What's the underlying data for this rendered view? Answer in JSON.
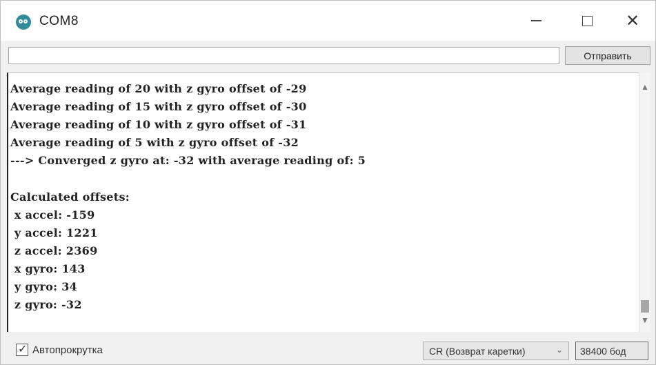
{
  "window": {
    "title": "COM8",
    "icon": "arduino-icon"
  },
  "input_row": {
    "value": "",
    "send_label": "Отправить"
  },
  "output_lines": [
    "Average reading of 20 with z gyro offset of -29",
    "Average reading of 15 with z gyro offset of -30",
    "Average reading of 10 with z gyro offset of -31",
    "Average reading of 5 with z gyro offset of -32",
    "---> Converged z gyro at: -32 with average reading of: 5",
    "",
    "Calculated offsets:",
    " x accel: -159",
    " y accel: 1221",
    " z accel: 2369",
    " x gyro: 143",
    " y gyro: 34",
    " z gyro: -32"
  ],
  "bottom": {
    "autoscroll_label": "Автопрокрутка",
    "autoscroll_checked": true,
    "line_ending": "CR (Возврат каретки)",
    "baud": "38400 бод"
  }
}
